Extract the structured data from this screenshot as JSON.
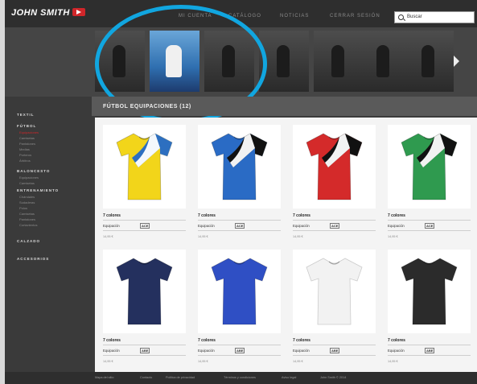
{
  "header": {
    "logo": "JOHN SMITH",
    "nav": [
      "MI CUENTA",
      "CATÁLOGO",
      "NOTICIAS",
      "CERRAR SESIÓN"
    ],
    "search_text": "Buscar"
  },
  "carousel": {
    "slides": [
      "",
      "",
      "",
      "",
      "",
      "",
      ""
    ]
  },
  "sidebar": {
    "categories": [
      {
        "label": "TEXTIL",
        "items": []
      },
      {
        "label": "FÚTBOL",
        "items": [
          "Equipaciones",
          "Camisetas",
          "Pantalones",
          "Medias",
          "Porteros",
          "Árbitros"
        ]
      },
      {
        "label": "BALONCESTO",
        "items": [
          "Equipaciones",
          "Camisetas"
        ]
      },
      {
        "label": "ENTRENAMIENTO",
        "items": [
          "Chándales",
          "Sudaderas",
          "Polos",
          "Camisetas",
          "Pantalones",
          "Cortavientos"
        ]
      },
      {
        "label": "CALZADO",
        "items": []
      },
      {
        "label": "ACCESORIOS",
        "items": []
      }
    ]
  },
  "section": {
    "title": "FÚTBOL EQUIPACIONES (12)"
  },
  "products": [
    {
      "name": "7 colores",
      "desc": "Equipación",
      "badge": "ACE",
      "price": "14,95 €",
      "color": "#f2d51a",
      "accent": "#2d6fc0"
    },
    {
      "name": "7 colores",
      "desc": "Equipación",
      "badge": "ACE",
      "price": "14,95 €",
      "color": "#2a6bc5",
      "accent": "#111111"
    },
    {
      "name": "7 colores",
      "desc": "Equipación",
      "badge": "ACE",
      "price": "14,95 €",
      "color": "#d42a2a",
      "accent": "#111111"
    },
    {
      "name": "7 colores",
      "desc": "Equipación",
      "badge": "ACE",
      "price": "14,95 €",
      "color": "#2f9a4f",
      "accent": "#111111"
    },
    {
      "name": "7 colores",
      "desc": "Equipación",
      "badge": "ABE",
      "price": "14,95 €",
      "color": "#24305e",
      "accent": ""
    },
    {
      "name": "7 colores",
      "desc": "Equipación",
      "badge": "ABE",
      "price": "14,95 €",
      "color": "#2f4fc4",
      "accent": ""
    },
    {
      "name": "7 colores",
      "desc": "Equipación",
      "badge": "ABE",
      "price": "14,95 €",
      "color": "#f2f2f2",
      "accent": ""
    },
    {
      "name": "7 colores",
      "desc": "Equipación",
      "badge": "ABE",
      "price": "14,95 €",
      "color": "#2b2b2b",
      "accent": ""
    }
  ],
  "footer": {
    "links": [
      "Mapa del sitio",
      "Contacto",
      "Política de privacidad",
      "Términos y condiciones",
      "Aviso legal",
      "John Smith © 2014"
    ]
  },
  "colors": {
    "brand_red": "#d0262a",
    "highlight": "#11a6e0"
  }
}
